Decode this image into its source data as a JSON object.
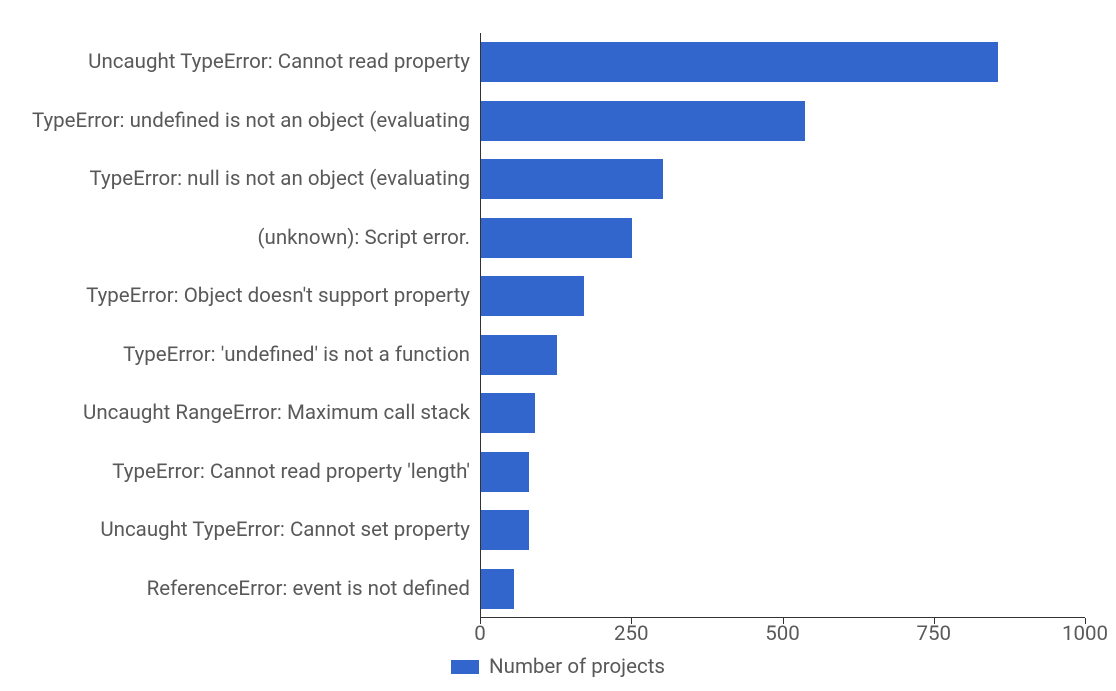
{
  "chart_data": {
    "type": "bar",
    "orientation": "horizontal",
    "categories": [
      "Uncaught TypeError: Cannot read property",
      "TypeError: undefined is not an object (evaluating",
      "TypeError: null is not an object (evaluating",
      "(unknown): Script error.",
      "TypeError: Object doesn't support property",
      "TypeError: 'undefined' is not a function",
      "Uncaught RangeError: Maximum call stack",
      "TypeError: Cannot read property 'length'",
      "Uncaught TypeError: Cannot set property",
      "ReferenceError: event is not defined"
    ],
    "series": [
      {
        "name": "Number of projects",
        "values": [
          855,
          535,
          300,
          250,
          170,
          125,
          90,
          80,
          80,
          55
        ]
      }
    ],
    "xlabel": "",
    "ylabel": "",
    "xlim": [
      0,
      1000
    ],
    "xticks": [
      0,
      250,
      500,
      750,
      1000
    ],
    "legend_position": "bottom",
    "colors": {
      "bar": "#3366cc"
    }
  },
  "legend": {
    "label": "Number of projects"
  }
}
